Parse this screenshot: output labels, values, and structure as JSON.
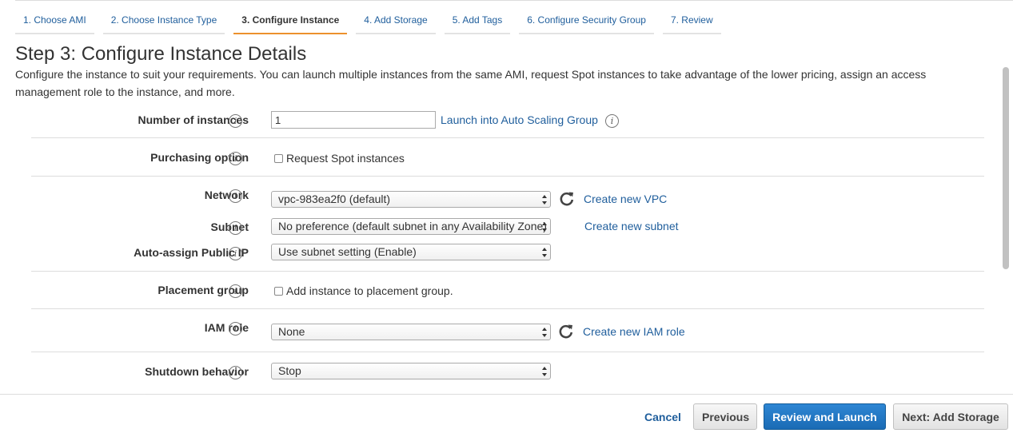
{
  "wizard": {
    "tabs": [
      {
        "label": "1. Choose AMI"
      },
      {
        "label": "2. Choose Instance Type"
      },
      {
        "label": "3. Configure Instance"
      },
      {
        "label": "4. Add Storage"
      },
      {
        "label": "5. Add Tags"
      },
      {
        "label": "6. Configure Security Group"
      },
      {
        "label": "7. Review"
      }
    ],
    "active_tab": "3. Configure Instance"
  },
  "page": {
    "title": "Step 3: Configure Instance Details",
    "intro": "Configure the instance to suit your requirements. You can launch multiple instances from the same AMI, request Spot instances to take advantage of the lower pricing, assign an access management role to the instance, and more."
  },
  "form": {
    "number_of_instances": {
      "label": "Number of instances",
      "value": "1",
      "link": "Launch into Auto Scaling Group"
    },
    "purchasing_option": {
      "label": "Purchasing option",
      "checkbox_label": "Request Spot instances",
      "checked": false
    },
    "network": {
      "label": "Network",
      "selected": "vpc-983ea2f0 (default)",
      "link": "Create new VPC"
    },
    "subnet": {
      "label": "Subnet",
      "selected": "No preference (default subnet in any Availability Zone)",
      "link": "Create new subnet"
    },
    "auto_assign_public_ip": {
      "label": "Auto-assign Public IP",
      "selected": "Use subnet setting (Enable)"
    },
    "placement_group": {
      "label": "Placement group",
      "checkbox_label": "Add instance to placement group.",
      "checked": false
    },
    "iam_role": {
      "label": "IAM role",
      "selected": "None",
      "link": "Create new IAM role"
    },
    "shutdown_behavior": {
      "label": "Shutdown behavior",
      "selected": "Stop"
    }
  },
  "footer": {
    "cancel": "Cancel",
    "previous": "Previous",
    "review_and_launch": "Review and Launch",
    "next": "Next: Add Storage"
  },
  "colors": {
    "link": "#1f5e9c",
    "active_tab_underline": "#ec912d",
    "primary_button": "#1a6bb5"
  },
  "icons": {
    "info": "info-icon",
    "refresh": "refresh-icon",
    "select_arrows": "updown-arrows-icon"
  }
}
